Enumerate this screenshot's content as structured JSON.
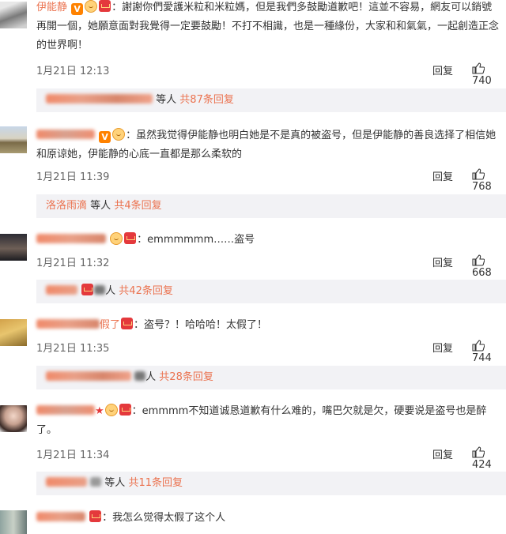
{
  "comments": [
    {
      "name": "伊能静",
      "text": "謝謝你們愛護米粒和米粒媽，但是我們多鼓勵道歉吧！這並不容易，網友可以銷號再開一個，她願意面對我覺得一定要鼓勵！不打不相識，也是一種緣份，大家和和氣氣，一起創造正念的世界啊！",
      "time": "1月21日 12:13",
      "reply_label": "回复",
      "likes": "740",
      "sub_people": "等人",
      "sub_total": "共87条回复"
    },
    {
      "text": "虽然我觉得伊能静也明白她是不是真的被盗号，但是伊能静的善良选择了相信她和原谅她，伊能静的心底一直都是那么柔软的",
      "time": "1月21日 11:39",
      "reply_label": "回复",
      "likes": "768",
      "sub_name": "洛洛雨滴",
      "sub_people": "等人",
      "sub_total": "共4条回复"
    },
    {
      "text": "emmmmmm……盗号",
      "time": "1月21日 11:32",
      "reply_label": "回复",
      "likes": "668",
      "sub_people": "人",
      "sub_total": "共42条回复"
    },
    {
      "name_tail": "假了",
      "text": "盗号？！哈哈哈！太假了！",
      "time": "1月21日 11:35",
      "reply_label": "回复",
      "likes": "744",
      "sub_people": "人",
      "sub_total": "共28条回复"
    },
    {
      "text": "emmmm不知道诚恳道歉有什么难的，嘴巴欠就是欠，硬要说是盗号也是醉了。",
      "time": "1月21日 11:34",
      "reply_label": "回复",
      "likes": "424",
      "sub_people": "等人",
      "sub_total": "共11条回复"
    },
    {
      "text": "我怎么觉得太假了这个人"
    }
  ],
  "badges": {
    "verified": "V"
  },
  "colors": {
    "accent": "#eb7350",
    "reply_bg": "#f2f2f5"
  },
  "icons": {
    "like": "thumbs-up-icon"
  }
}
